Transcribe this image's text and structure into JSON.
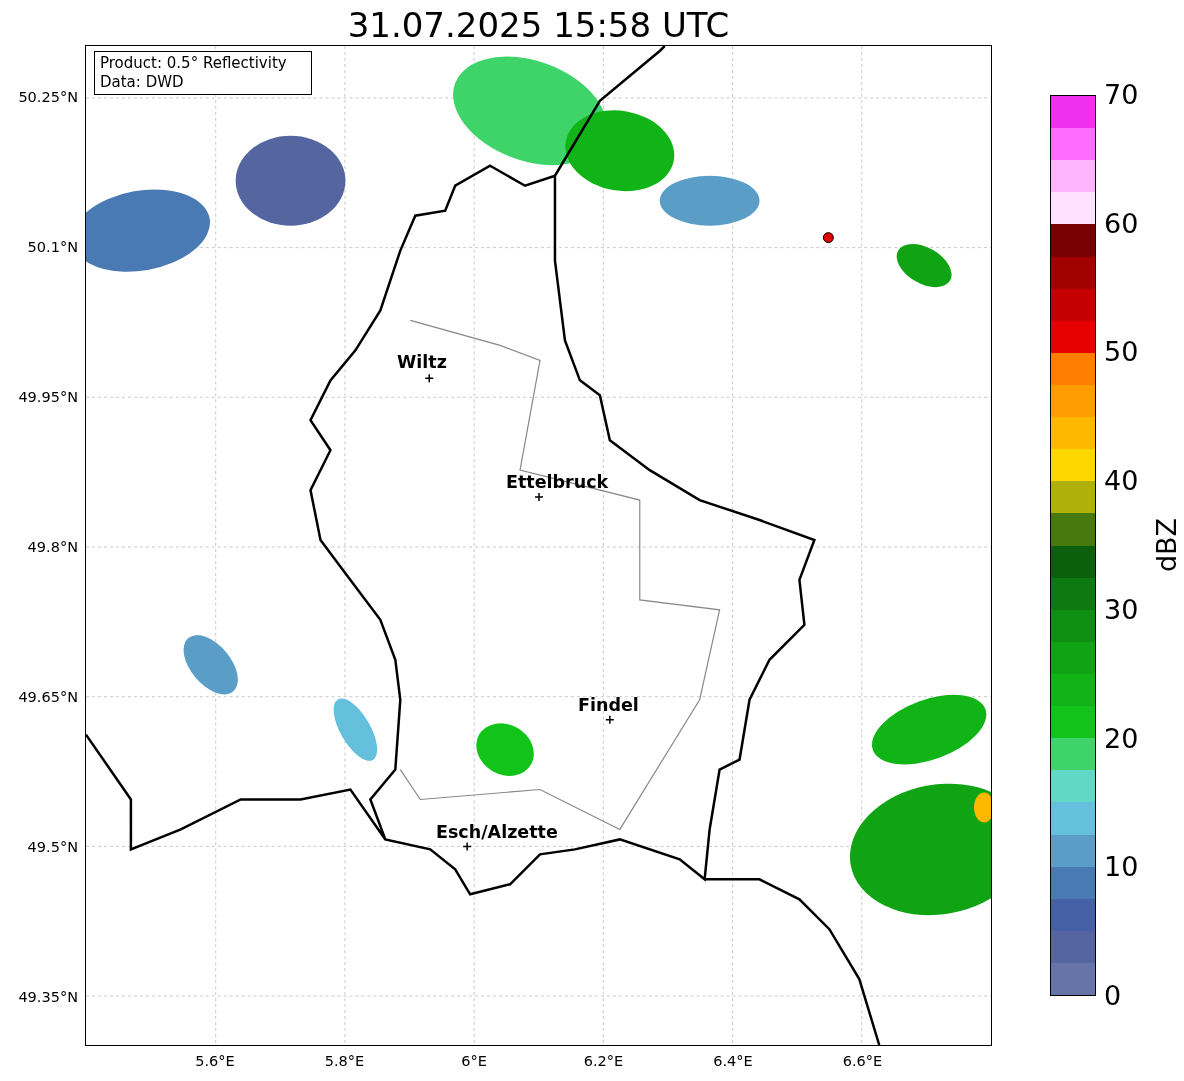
{
  "title": "31.07.2025 15:58 UTC",
  "info_box": [
    "Product: 0.5° Reflectivity",
    "Data: DWD"
  ],
  "y_ticks": [
    "50.25°N",
    "50.1°N",
    "49.95°N",
    "49.8°N",
    "49.65°N",
    "49.5°N",
    "49.35°N"
  ],
  "x_ticks": [
    "5.6°E",
    "5.8°E",
    "6°E",
    "6.2°E",
    "6.4°E",
    "6.6°E"
  ],
  "cities": [
    {
      "name": "Wiltz"
    },
    {
      "name": "Ettelbruck"
    },
    {
      "name": "Findel"
    },
    {
      "name": "Esch/Alzette"
    }
  ],
  "colorbar": {
    "label": "dBZ",
    "ticks": [
      "70",
      "60",
      "50",
      "40",
      "30",
      "20",
      "10",
      "0"
    ],
    "bins": [
      {
        "color": "#ee30ee"
      },
      {
        "color": "#ff6cff"
      },
      {
        "color": "#ffb4ff"
      },
      {
        "color": "#ffe0ff"
      },
      {
        "color": "#780000"
      },
      {
        "color": "#a00000"
      },
      {
        "color": "#c40000"
      },
      {
        "color": "#e60000"
      },
      {
        "color": "#ff7e00"
      },
      {
        "color": "#ff9c00"
      },
      {
        "color": "#ffb800"
      },
      {
        "color": "#ffd700"
      },
      {
        "color": "#b0b00a"
      },
      {
        "color": "#467a0e"
      },
      {
        "color": "#0a600c"
      },
      {
        "color": "#0c7a10"
      },
      {
        "color": "#0e8e12"
      },
      {
        "color": "#10a414"
      },
      {
        "color": "#10b416"
      },
      {
        "color": "#12c41a"
      },
      {
        "color": "#3ed46a"
      },
      {
        "color": "#60d8c8"
      },
      {
        "color": "#64c0dc"
      },
      {
        "color": "#5a9ec8"
      },
      {
        "color": "#4a7ab4"
      },
      {
        "color": "#4660a6"
      },
      {
        "color": "#5565a0"
      },
      {
        "color": "#6674a8"
      }
    ]
  }
}
